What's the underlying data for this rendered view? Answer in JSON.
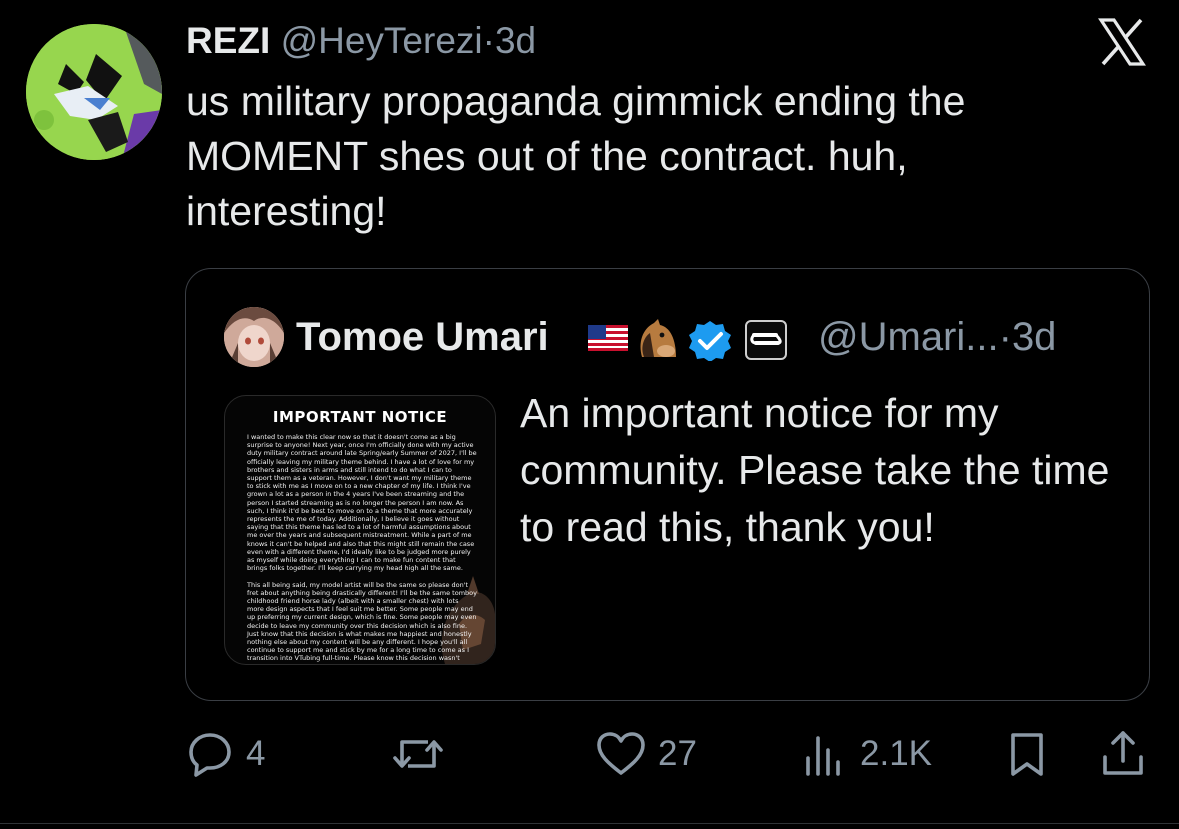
{
  "tweet": {
    "name": "REZI",
    "handle": "@HeyTerezi",
    "separator": "·",
    "time": "3d",
    "text": "us military propaganda gimmick ending the MOMENT shes out of the contract. huh, interesting!"
  },
  "quote": {
    "name": "Tomoe Umari",
    "badges": [
      "us-flag-emoji",
      "horse-emoji",
      "verified-icon",
      "affiliate-badge-icon"
    ],
    "handle": "@Umari...",
    "separator": "·",
    "time": "3d",
    "text": "An important notice for my community. Please take the time to read this, thank you!",
    "image": {
      "title": "IMPORTANT NOTICE",
      "paragraph1": "I wanted to make this clear now so that it doesn't come as a big surprise to anyone! Next year, once I'm officially done with my active duty military contract around late Spring/early Summer of 2027, I'll be officially leaving my military theme behind. I have a lot of love for my brothers and sisters in arms and still intend to do what I can to support them as a veteran. However, I don't want my military theme to stick with me as I move on to a new chapter of my life. I think I've grown a lot as a person in the 4 years I've been streaming and the person I started streaming as is no longer the person I am now. As such, I think it'd be best to move on to a theme that more accurately represents the me of today. Additionally, I believe it goes without saying that this theme has led to a lot of harmful assumptions about me over the years and subsequent mistreatment. While a part of me knows it can't be helped and also that this might still remain the case even with a different theme, I'd ideally like to be judged more purely as myself while doing everything I can to make fun content that brings folks together. I'll keep carrying my head high all the same.",
      "paragraph2": "This all being said, my model artist will be the same so please don't fret about anything being drastically different! I'll be the same tomboy childhood friend horse lady (albeit with a smaller chest) with lots more design aspects that I feel suit me better. Some people may end up preferring my current design, which is fine. Some people may even decide to leave my community over this decision which is also fine. Just know that this decision is what makes me happiest and honestly nothing else about my content will be any different. I hope you'll all continue to support me and stick by me for a long time to come as I transition into VTubing full-time. Please know this decision wasn't made lightly and that I'll keep doing my very best for my community."
    }
  },
  "actions": {
    "replies": "4",
    "reposts": "",
    "likes": "27",
    "views": "2.1K"
  },
  "colors": {
    "background": "#000000",
    "text": "#e7e9ea",
    "muted": "#8b98a5",
    "border": "#3a3e44",
    "verified": "#1d9bf0",
    "avatar_green": "#97d64e"
  }
}
